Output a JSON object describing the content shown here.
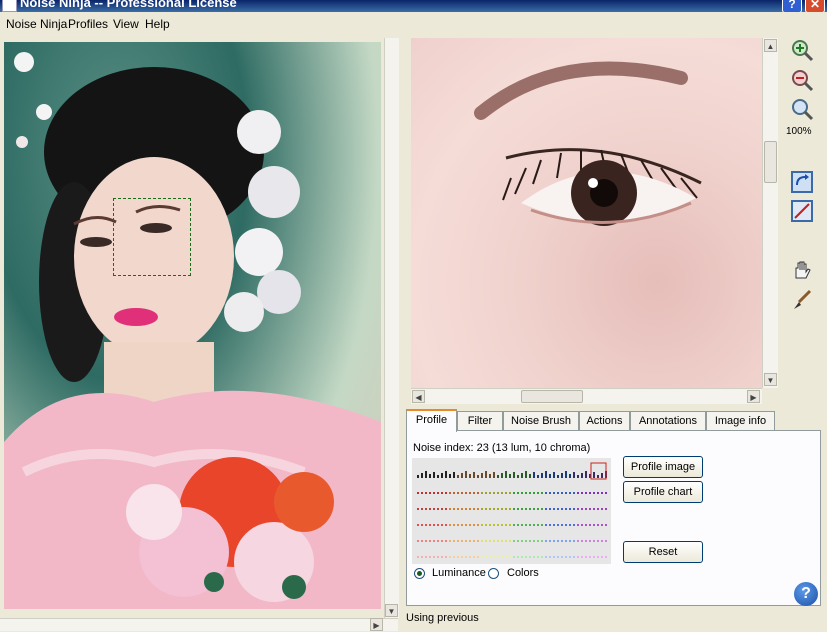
{
  "window": {
    "title": "Noise Ninja -- Professional License",
    "help_glyph": "?",
    "close_glyph": "✕"
  },
  "menu": {
    "items": [
      "Noise Ninja",
      "Profiles",
      "View",
      "Help"
    ]
  },
  "tools": {
    "zoom_level": "100%",
    "icons": [
      "zoom-in-icon",
      "zoom-out-icon",
      "zoom-fit-icon",
      "rotate-icon",
      "crop-icon",
      "hand-icon",
      "brush-icon"
    ]
  },
  "tabs": [
    "Profile",
    "Filter",
    "Noise Brush",
    "Actions",
    "Annotations",
    "Image info"
  ],
  "profile": {
    "noise_index": "Noise index:  23 (13 lum, 10 chroma)",
    "profile_image_label": "Profile image",
    "profile_chart_label": "Profile chart",
    "reset_label": "Reset",
    "radio_luminance": "Luminance",
    "radio_colors": "Colors",
    "selected": "Luminance"
  },
  "status": {
    "text": "Using previous"
  },
  "colors": {
    "accent_tab": "#e68b2c",
    "selection_box": "#1a6b1a"
  }
}
